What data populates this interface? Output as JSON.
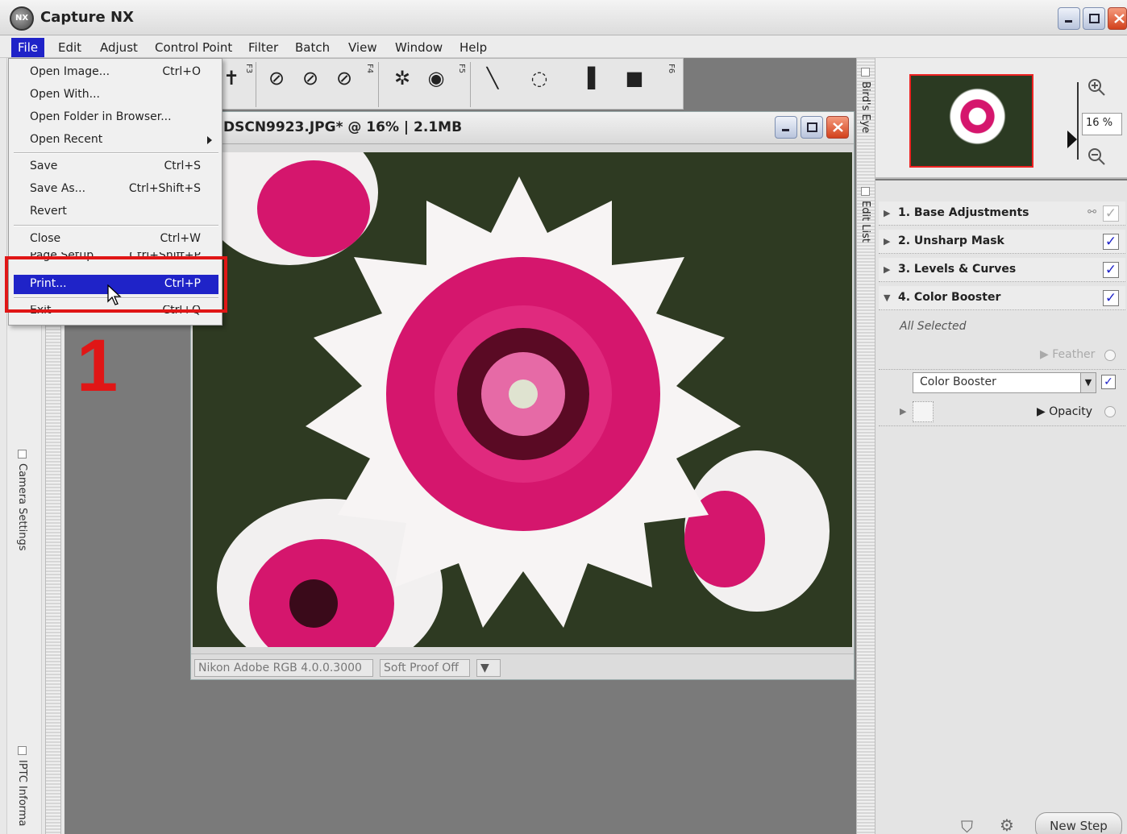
{
  "app": {
    "title": "Capture NX",
    "logo_text": "NX"
  },
  "menubar": [
    "File",
    "Edit",
    "Adjust",
    "Control Point",
    "Filter",
    "Batch",
    "View",
    "Window",
    "Help"
  ],
  "file_menu": {
    "items": [
      {
        "label": "Open Image...",
        "shortcut": "Ctrl+O"
      },
      {
        "label": "Open With...",
        "shortcut": ""
      },
      {
        "label": "Open Folder in Browser...",
        "shortcut": ""
      },
      {
        "label": "Open Recent",
        "shortcut": ""
      },
      {
        "label": "Save",
        "shortcut": "Ctrl+S"
      },
      {
        "label": "Save As...",
        "shortcut": "Ctrl+Shift+S"
      },
      {
        "label": "Revert",
        "shortcut": ""
      },
      {
        "label": "Close",
        "shortcut": "Ctrl+W"
      },
      {
        "label": "Page Setup...",
        "shortcut": "Ctrl+Shift+P"
      },
      {
        "label": "Print...",
        "shortcut": "Ctrl+P"
      },
      {
        "label": "Exit",
        "shortcut": "Ctrl+Q"
      }
    ]
  },
  "annotation": {
    "step_number": "1",
    "highlight_color": "#e01616"
  },
  "toolbar": {
    "group_labels": [
      "F3",
      "F4",
      "F5",
      "F6"
    ]
  },
  "document": {
    "title": "DSCN9923.JPG* @ 16% | 2.1MB",
    "color_profile": "Nikon Adobe RGB 4.0.0.3000",
    "soft_proof": "Soft Proof Off"
  },
  "left_panel": {
    "tabs": [
      "Camera Settings",
      "IPTC Informa"
    ]
  },
  "right_panel": {
    "tabs": [
      "Bird's Eye",
      "Edit List"
    ],
    "zoom_value": "16",
    "zoom_unit": "%",
    "steps": [
      {
        "label": "1. Base Adjustments",
        "checked": true,
        "expanded": false
      },
      {
        "label": "2. Unsharp Mask",
        "checked": true,
        "expanded": false
      },
      {
        "label": "3. Levels & Curves",
        "checked": true,
        "expanded": false
      },
      {
        "label": "4. Color Booster",
        "checked": true,
        "expanded": true
      }
    ],
    "selection_text": "All Selected",
    "feather_label": "Feather",
    "filter_select": "Color Booster",
    "opacity_label": "Opacity",
    "new_step_label": "New Step"
  },
  "colors": {
    "accent": "#1f23c8",
    "highlight_red": "#e01616",
    "flower_pink": "#d5166d"
  }
}
